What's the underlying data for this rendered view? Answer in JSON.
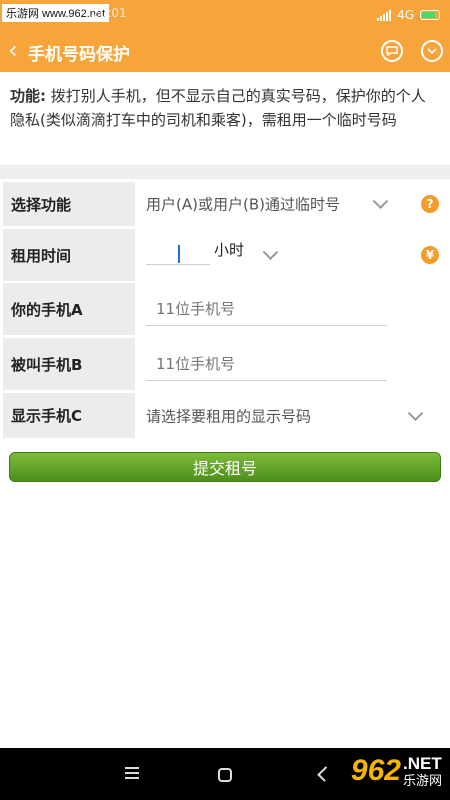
{
  "status": {
    "watermark": "乐游网 www.962.net",
    "time": "20:01",
    "network": "4G"
  },
  "header": {
    "title": "手机号码保护",
    "back_icon": "chevron-left-icon",
    "chat_icon": "chat-bubble-icon",
    "menu_icon": "chevron-down-circle-icon",
    "background": "#f7a43b"
  },
  "intro": {
    "label": "功能:",
    "text": " 拨打别人手机，但不显示自己的真实号码，保护你的个人隐私(类似滴滴打车中的司机和乘客)，需租用一个临时号码"
  },
  "form": {
    "function": {
      "label": "选择功能",
      "value": "用户(A)或用户(B)通过临时号",
      "help_icon": "?"
    },
    "rental": {
      "label": "租用时间",
      "value": "",
      "unit": "小时",
      "price_icon": "¥"
    },
    "phone_a": {
      "label": "你的手机A",
      "placeholder": "11位手机号"
    },
    "phone_b": {
      "label": "被叫手机B",
      "placeholder": "11位手机号"
    },
    "phone_c": {
      "label": "显示手机C",
      "value": "请选择要租用的显示号码"
    }
  },
  "submit": {
    "label": "提交租号",
    "color": "#5ea02a"
  },
  "system_nav": {
    "watermark_logo": "962",
    "watermark_net": ".NET",
    "watermark_cn": "乐游网"
  }
}
